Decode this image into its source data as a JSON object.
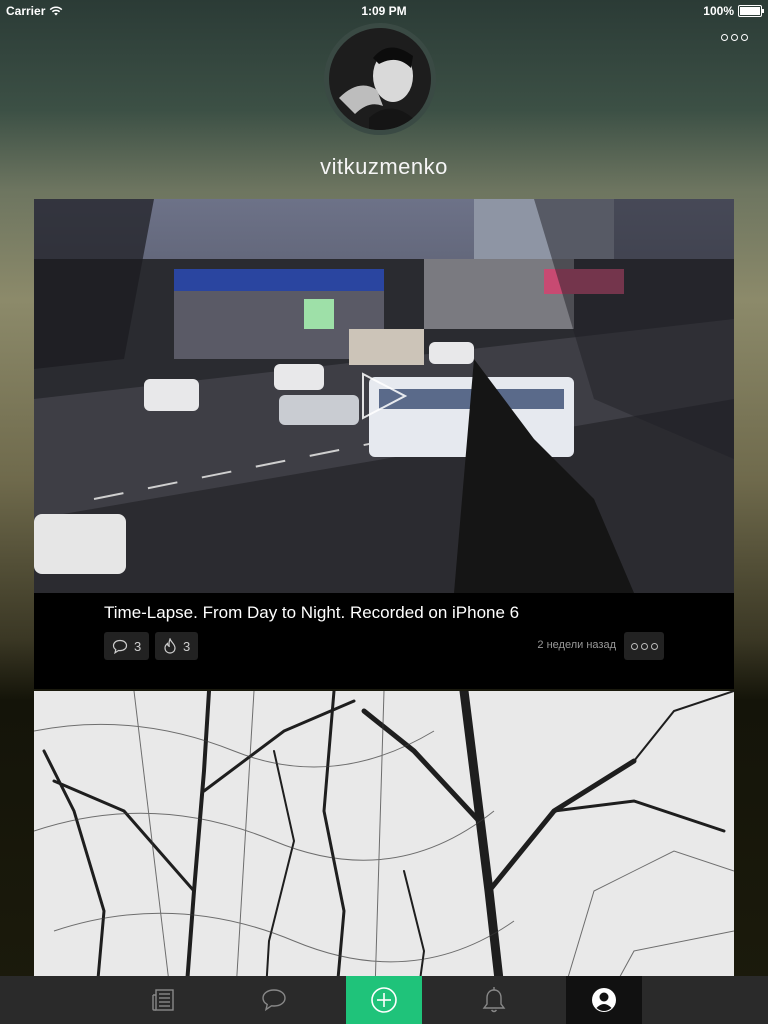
{
  "status_bar": {
    "carrier": "Carrier",
    "time": "1:09 PM",
    "battery": "100%",
    "battery_level": 1.0
  },
  "profile": {
    "username": "vitkuzmenko"
  },
  "posts": [
    {
      "caption": "Time-Lapse. From Day to Night. Recorded on iPhone 6",
      "comments": "3",
      "likes": "3",
      "time_ago": "2 недели назад"
    }
  ],
  "icons": {
    "menu": "more-horizontal-icon",
    "play": "play-icon",
    "comment": "comment-icon",
    "like": "flame-icon",
    "tabs": [
      "feed-icon",
      "messages-icon",
      "add-icon",
      "notifications-icon",
      "profile-icon"
    ]
  },
  "colors": {
    "accent": "#1fc37a",
    "tab_bar": "#2a2a2a",
    "tab_active": "#111111"
  }
}
